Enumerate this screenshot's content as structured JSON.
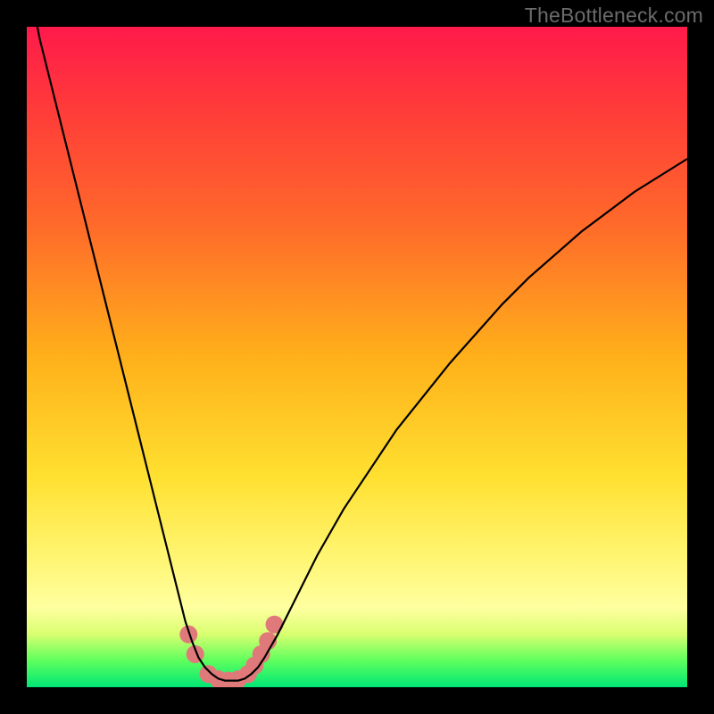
{
  "watermark": "TheBottleneck.com",
  "colors": {
    "frame": "#000000",
    "gradient_top": "#ff1a4b",
    "gradient_mid": "#ffe030",
    "gradient_bottom": "#00e676",
    "curve": "#000000",
    "markers": "#e07a7a"
  },
  "chart_data": {
    "type": "line",
    "title": "",
    "xlabel": "",
    "ylabel": "",
    "xlim": [
      0,
      100
    ],
    "ylim": [
      0,
      100
    ],
    "series": [
      {
        "name": "bottleneck-curve",
        "x": [
          0,
          2,
          4,
          6,
          8,
          10,
          12,
          14,
          16,
          18,
          20,
          22,
          24,
          25,
          26,
          27,
          28,
          29,
          30,
          31,
          32,
          33,
          34,
          35,
          36,
          38,
          40,
          44,
          48,
          52,
          56,
          60,
          64,
          68,
          72,
          76,
          80,
          84,
          88,
          92,
          96,
          100
        ],
        "y": [
          108,
          98,
          90,
          82,
          74,
          66,
          58,
          50,
          42,
          34,
          26,
          18,
          10,
          7,
          4.5,
          3,
          2,
          1.3,
          1.0,
          1.0,
          1.0,
          1.3,
          2,
          3,
          4.5,
          8,
          12,
          20,
          27,
          33,
          39,
          44,
          49,
          53.5,
          58,
          62,
          65.5,
          69,
          72,
          75,
          77.5,
          80
        ],
        "note": "y is percent of vertical axis (0 = bottom green, 100 = top red). First point y>100 because curve enters from above frame at left edge of plot."
      }
    ],
    "markers": {
      "name": "highlighted-band",
      "points": [
        {
          "x": 24.5,
          "y": 8.0
        },
        {
          "x": 25.5,
          "y": 5.0
        },
        {
          "x": 27.5,
          "y": 2.0
        },
        {
          "x": 29.0,
          "y": 1.2
        },
        {
          "x": 30.5,
          "y": 1.0
        },
        {
          "x": 32.0,
          "y": 1.2
        },
        {
          "x": 33.5,
          "y": 2.0
        },
        {
          "x": 34.5,
          "y": 3.3
        },
        {
          "x": 35.5,
          "y": 5.0
        },
        {
          "x": 36.5,
          "y": 7.0
        },
        {
          "x": 37.5,
          "y": 9.5
        }
      ],
      "radius_px": 10
    }
  }
}
